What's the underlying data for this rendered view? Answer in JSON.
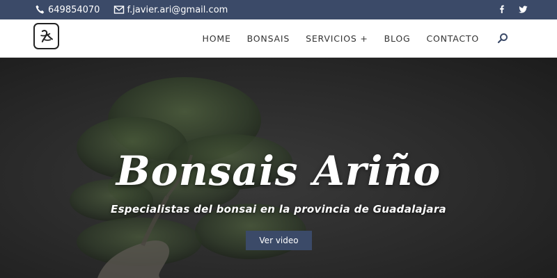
{
  "topbar": {
    "phone": "649854070",
    "email": "f.javier.ari@gmail.com",
    "social": [
      "facebook-icon",
      "twitter-icon"
    ]
  },
  "header": {
    "nav": [
      {
        "label": "HOME"
      },
      {
        "label": "BONSAIS"
      },
      {
        "label": "SERVICIOS +"
      },
      {
        "label": "BLOG"
      },
      {
        "label": "CONTACTO"
      }
    ]
  },
  "hero": {
    "title": "Bonsais Ariño",
    "subtitle": "Especialistas del bonsai en la provincia de Guadalajara",
    "button_label": "Ver video"
  },
  "colors": {
    "accent": "#3b4a68",
    "text": "#333333",
    "hero_bg": "#2a2a2a"
  }
}
